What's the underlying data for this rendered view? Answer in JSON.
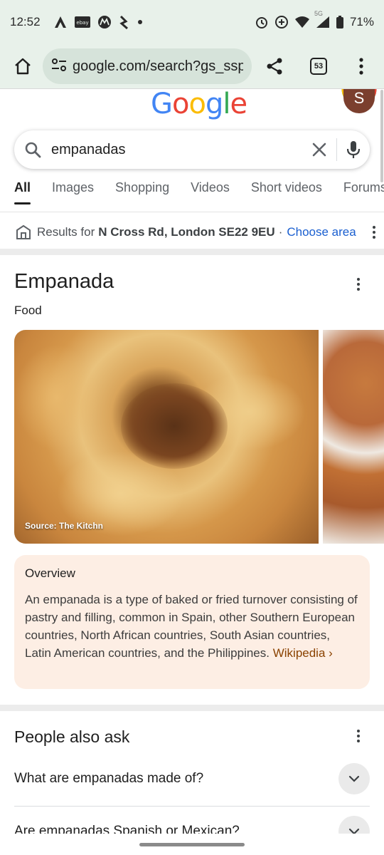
{
  "status_bar": {
    "time": "12:52",
    "battery": "71%",
    "network": "5G",
    "icons": [
      "a-logo-icon",
      "ebay-icon",
      "motorola-icon",
      "maps-icon",
      "dot-icon",
      "alarm-icon",
      "data-saver-icon",
      "wifi-icon",
      "signal-icon",
      "battery-icon"
    ]
  },
  "toolbar": {
    "url": "google.com/search?gs_ssp",
    "tab_count": "53",
    "icons": [
      "home-icon",
      "site-settings-icon",
      "share-icon",
      "tabs-icon",
      "more-vert-icon"
    ]
  },
  "header": {
    "logo": "Google",
    "logo_colors": [
      "#4285F4",
      "#EA4335",
      "#FBBC05",
      "#4285F4",
      "#34A853",
      "#EA4335"
    ],
    "avatar_letter": "S"
  },
  "search": {
    "query": "empanadas"
  },
  "tabs": [
    {
      "label": "All",
      "active": true
    },
    {
      "label": "Images",
      "active": false
    },
    {
      "label": "Shopping",
      "active": false
    },
    {
      "label": "Videos",
      "active": false
    },
    {
      "label": "Short videos",
      "active": false
    },
    {
      "label": "Forums",
      "active": false
    }
  ],
  "location": {
    "prefix": "Results for",
    "place": "N Cross Rd, London SE22 9EU",
    "separator": "·",
    "action": "Choose area"
  },
  "knowledge_panel": {
    "title": "Empanada",
    "subtitle": "Food",
    "image_caption": "Source: The Kitchn",
    "overview": {
      "heading": "Overview",
      "text": "An empanada is a type of baked or fried turnover consisting of pastry and filling, common in Spain, other Southern European countries, North African countries, South Asian countries, Latin American countries, and the Philippines.",
      "link": "Wikipedia ›"
    }
  },
  "people_also_ask": {
    "title": "People also ask",
    "questions": [
      "What are empanadas made of?",
      "Are empanadas Spanish or Mexican?"
    ]
  },
  "colors": {
    "chrome_bg": "#e8f1ea",
    "omnibox_bg": "#d6e3da",
    "link_blue": "#1a5fd0",
    "overview_bg": "#fdeee4",
    "wikipedia_link": "#8a4200"
  }
}
